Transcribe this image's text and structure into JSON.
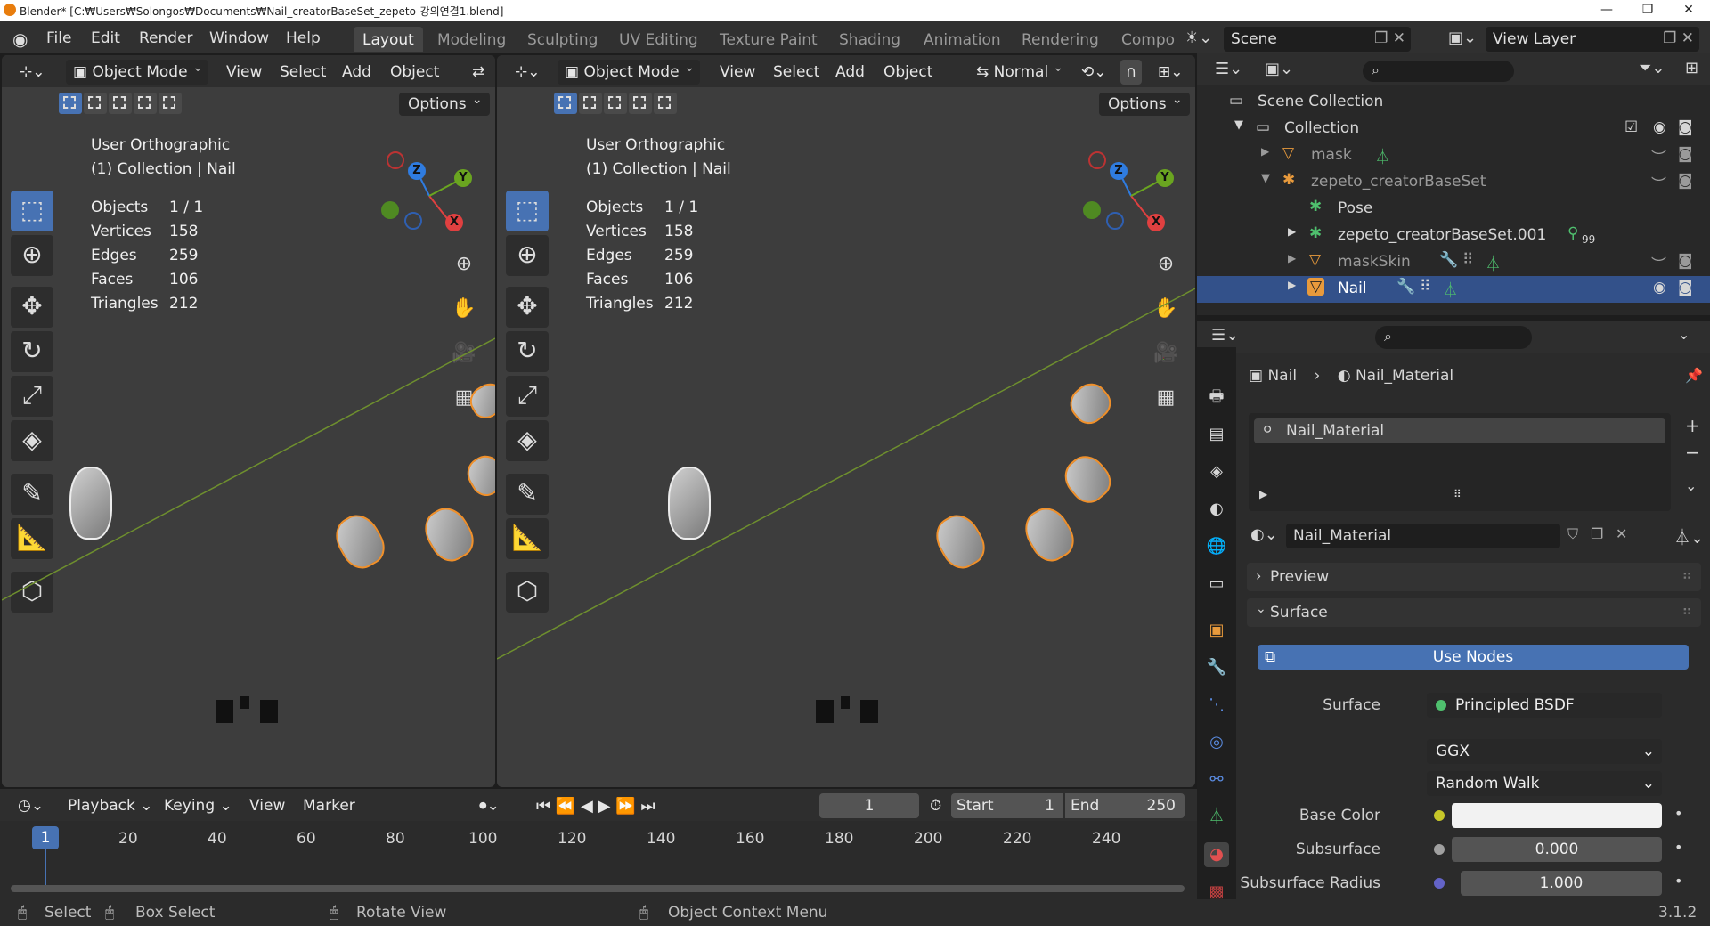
{
  "window": {
    "title": "Blender* [C:₩Users₩Solongos₩Documents₩Nail_creatorBaseSet_zepeto-강의연결1.blend]",
    "minimize": "—",
    "maximize": "❐",
    "close": "✕"
  },
  "menu": {
    "items": [
      "File",
      "Edit",
      "Render",
      "Window",
      "Help"
    ]
  },
  "workspaces": [
    "Layout",
    "Modeling",
    "Sculpting",
    "UV Editing",
    "Texture Paint",
    "Shading",
    "Animation",
    "Rendering",
    "Compo"
  ],
  "scene": {
    "name": "Scene",
    "view_layer": "View Layer"
  },
  "viewport_left": {
    "mode": "Object Mode",
    "menus": [
      "View",
      "Select",
      "Add",
      "Object"
    ],
    "options": "Options",
    "view_name": "User Orthographic",
    "collection": "(1) Collection | Nail",
    "stats": [
      {
        "k": "Objects",
        "v": "1 / 1"
      },
      {
        "k": "Vertices",
        "v": "158"
      },
      {
        "k": "Edges",
        "v": "259"
      },
      {
        "k": "Faces",
        "v": "106"
      },
      {
        "k": "Triangles",
        "v": "212"
      }
    ]
  },
  "viewport_right": {
    "mode": "Object Mode",
    "menus": [
      "View",
      "Select",
      "Add",
      "Object"
    ],
    "orientation": "Normal",
    "options": "Options",
    "view_name": "User Orthographic",
    "collection": "(1) Collection | Nail",
    "stats": [
      {
        "k": "Objects",
        "v": "1 / 1"
      },
      {
        "k": "Vertices",
        "v": "158"
      },
      {
        "k": "Edges",
        "v": "259"
      },
      {
        "k": "Faces",
        "v": "106"
      },
      {
        "k": "Triangles",
        "v": "212"
      }
    ]
  },
  "gizmo": {
    "x": "X",
    "y": "Y",
    "z": "Z"
  },
  "outliner": {
    "rows": [
      {
        "label": "Scene Collection"
      },
      {
        "label": "Collection"
      },
      {
        "label": "mask"
      },
      {
        "label": "zepeto_creatorBaseSet"
      },
      {
        "label": "Pose"
      },
      {
        "label": "zepeto_creatorBaseSet.001",
        "badge": "99"
      },
      {
        "label": "maskSkin"
      },
      {
        "label": "Nail"
      }
    ]
  },
  "properties": {
    "breadcrumb_object": "Nail",
    "breadcrumb_material": "Nail_Material",
    "slot": "Nail_Material",
    "material_name": "Nail_Material",
    "preview": "Preview",
    "surface_panel": "Surface",
    "use_nodes": "Use Nodes",
    "surface_label": "Surface",
    "surface_value": "Principled BSDF",
    "distribution": "GGX",
    "subsurface_method": "Random Walk",
    "base_color_label": "Base Color",
    "subsurface_label": "Subsurface",
    "subsurface_value": "0.000",
    "ss_radius_label": "Subsurface Radius",
    "ss_radius_value": "1.000"
  },
  "timeline": {
    "menus": [
      "Playback",
      "Keying",
      "View",
      "Marker"
    ],
    "current_frame": "1",
    "start_label": "Start",
    "start_value": "1",
    "end_label": "End",
    "end_value": "250",
    "ticks": [
      "20",
      "40",
      "60",
      "80",
      "100",
      "120",
      "140",
      "160",
      "180",
      "200",
      "220",
      "240"
    ],
    "playhead": "1"
  },
  "status": {
    "select": "Select",
    "box_select": "Box Select",
    "rotate_view": "Rotate View",
    "context_menu": "Object Context Menu",
    "version": "3.1.2"
  }
}
